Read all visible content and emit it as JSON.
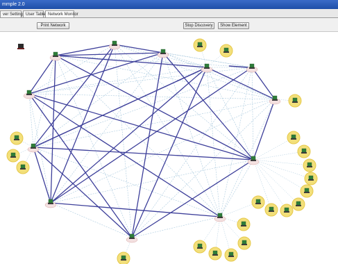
{
  "window": {
    "title": "mmple 2.0"
  },
  "tabs": [
    {
      "label": "ver Settings",
      "active": false
    },
    {
      "label": "User Table",
      "active": false
    },
    {
      "label": "Network Monitor",
      "active": true
    }
  ],
  "toolbar": {
    "left_button": "Print Network",
    "center_button": "Stop Discovery",
    "right_button": "Show Element"
  },
  "colors": {
    "link_strong": "#3d3f9a",
    "link_light": "#a9c9de",
    "node_ring": "#e6c84a",
    "node_fill": "#f2df7a",
    "icon_green": "#2f7d3a"
  }
}
